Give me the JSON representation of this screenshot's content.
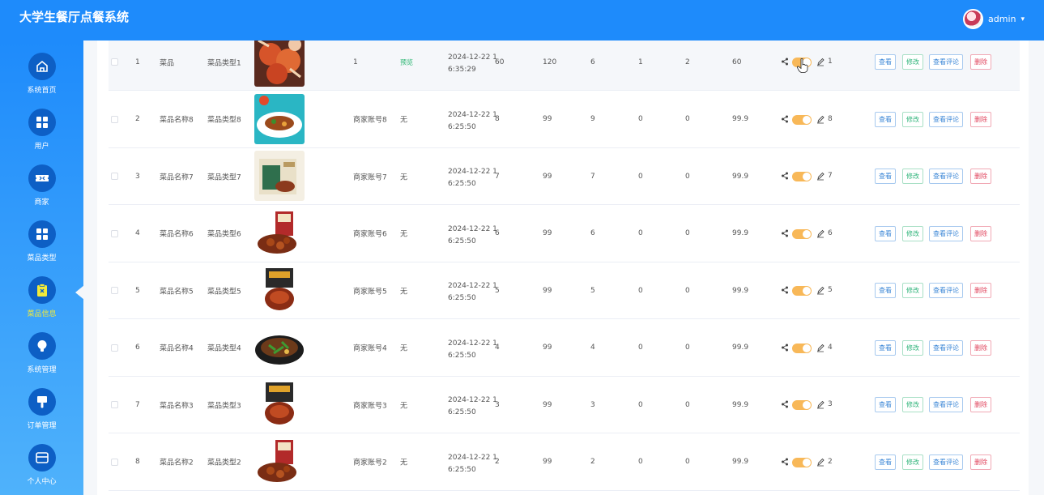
{
  "header": {
    "title": "大学生餐厅点餐系统",
    "username": "admin",
    "caret": "▾"
  },
  "sidebar": {
    "items": [
      {
        "label": "系统首页",
        "icon": "home-icon"
      },
      {
        "label": "用户",
        "icon": "grid-icon"
      },
      {
        "label": "商家",
        "icon": "ticket-icon"
      },
      {
        "label": "菜品类型",
        "icon": "grid-icon"
      },
      {
        "label": "菜品信息",
        "icon": "clipboard-icon",
        "active": true
      },
      {
        "label": "系统管理",
        "icon": "bulb-icon"
      },
      {
        "label": "订单管理",
        "icon": "brush-icon"
      },
      {
        "label": "个人中心",
        "icon": "card-icon"
      }
    ]
  },
  "table": {
    "buttons": {
      "view": "查看",
      "edit": "修改",
      "comment": "查看评论",
      "delete": "删除"
    },
    "rows": [
      {
        "index": "1",
        "name": "菜品",
        "type": "菜品类型1",
        "merchant": "1",
        "extra": "预览",
        "extra_link": true,
        "date_line1": "2024-12-22 1",
        "date_line2": "6:35:29",
        "c1": "60",
        "c2": "120",
        "c3": "6",
        "c4": "1",
        "c5": "2",
        "price": "60",
        "likes": "1",
        "img": "crab"
      },
      {
        "index": "2",
        "name": "菜品名称8",
        "type": "菜品类型8",
        "merchant": "商家账号8",
        "extra": "无",
        "extra_link": false,
        "date_line1": "2024-12-22 1",
        "date_line2": "6:25:50",
        "c1": "8",
        "c2": "99",
        "c3": "9",
        "c4": "0",
        "c5": "0",
        "price": "99.9",
        "likes": "8",
        "img": "plate"
      },
      {
        "index": "3",
        "name": "菜品名称7",
        "type": "菜品类型7",
        "merchant": "商家账号7",
        "extra": "无",
        "extra_link": false,
        "date_line1": "2024-12-22 1",
        "date_line2": "6:25:50",
        "c1": "7",
        "c2": "99",
        "c3": "7",
        "c4": "0",
        "c5": "0",
        "price": "99.9",
        "likes": "7",
        "img": "box"
      },
      {
        "index": "4",
        "name": "菜品名称6",
        "type": "菜品类型6",
        "merchant": "商家账号6",
        "extra": "无",
        "extra_link": false,
        "date_line1": "2024-12-22 1",
        "date_line2": "6:25:50",
        "c1": "6",
        "c2": "99",
        "c3": "6",
        "c4": "0",
        "c5": "0",
        "price": "99.9",
        "likes": "6",
        "img": "bowl"
      },
      {
        "index": "5",
        "name": "菜品名称5",
        "type": "菜品类型5",
        "merchant": "商家账号5",
        "extra": "无",
        "extra_link": false,
        "date_line1": "2024-12-22 1",
        "date_line2": "6:25:50",
        "c1": "5",
        "c2": "99",
        "c3": "5",
        "c4": "0",
        "c5": "0",
        "price": "99.9",
        "likes": "5",
        "img": "pack"
      },
      {
        "index": "6",
        "name": "菜品名称4",
        "type": "菜品类型4",
        "merchant": "商家账号4",
        "extra": "无",
        "extra_link": false,
        "date_line1": "2024-12-22 1",
        "date_line2": "6:25:50",
        "c1": "4",
        "c2": "99",
        "c3": "4",
        "c4": "0",
        "c5": "0",
        "price": "99.9",
        "likes": "4",
        "img": "pot"
      },
      {
        "index": "7",
        "name": "菜品名称3",
        "type": "菜品类型3",
        "merchant": "商家账号3",
        "extra": "无",
        "extra_link": false,
        "date_line1": "2024-12-22 1",
        "date_line2": "6:25:50",
        "c1": "3",
        "c2": "99",
        "c3": "3",
        "c4": "0",
        "c5": "0",
        "price": "99.9",
        "likes": "3",
        "img": "pack"
      },
      {
        "index": "8",
        "name": "菜品名称2",
        "type": "菜品类型2",
        "merchant": "商家账号2",
        "extra": "无",
        "extra_link": false,
        "date_line1": "2024-12-22 1",
        "date_line2": "6:25:50",
        "c1": "2",
        "c2": "99",
        "c3": "2",
        "c4": "0",
        "c5": "0",
        "price": "99.9",
        "likes": "2",
        "img": "bowl"
      }
    ]
  },
  "colors": {
    "primary": "#1e8bfb",
    "toggle": "#f8b858",
    "active_label": "#f2ea3a",
    "link_green": "#21b36b"
  }
}
